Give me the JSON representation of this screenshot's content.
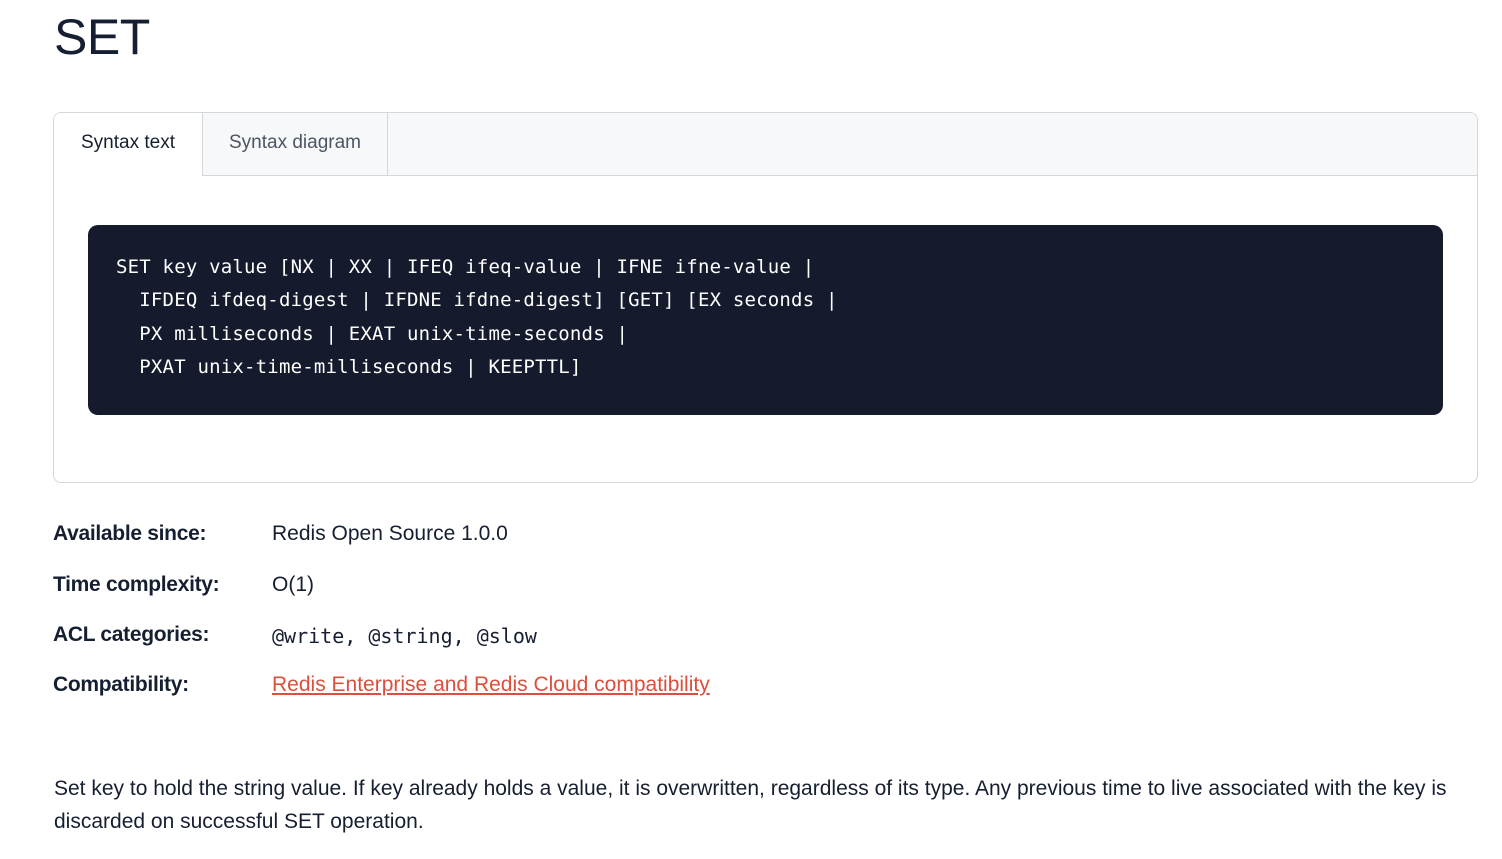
{
  "page": {
    "title": "SET"
  },
  "syntax": {
    "tabs": [
      {
        "label": "Syntax text"
      },
      {
        "label": "Syntax diagram"
      }
    ],
    "code_lines": [
      "SET key value [NX | XX | IFEQ ifeq-value | IFNE ifne-value |",
      "  IFDEQ ifdeq-digest | IFDNE ifdne-digest] [GET] [EX seconds |",
      "  PX milliseconds | EXAT unix-time-seconds |",
      "  PXAT unix-time-milliseconds | KEEPTTL]"
    ]
  },
  "meta": {
    "available_since": {
      "label": "Available since:",
      "value": "Redis Open Source 1.0.0"
    },
    "time_complexity": {
      "label": "Time complexity:",
      "value": "O(1)"
    },
    "acl_categories": {
      "label": "ACL categories:",
      "value": "@write, @string, @slow"
    },
    "compatibility": {
      "label": "Compatibility:",
      "link_text": "Redis Enterprise and Redis Cloud compatibility"
    }
  },
  "description": {
    "text": "Set key to hold the string value. If key already holds a value, it is overwritten, regardless of its type. Any previous time to live associated with the key is discarded on successful SET operation."
  },
  "colors": {
    "code_background": "#151a2d",
    "link": "#dc4f3c",
    "text": "#161f31"
  }
}
